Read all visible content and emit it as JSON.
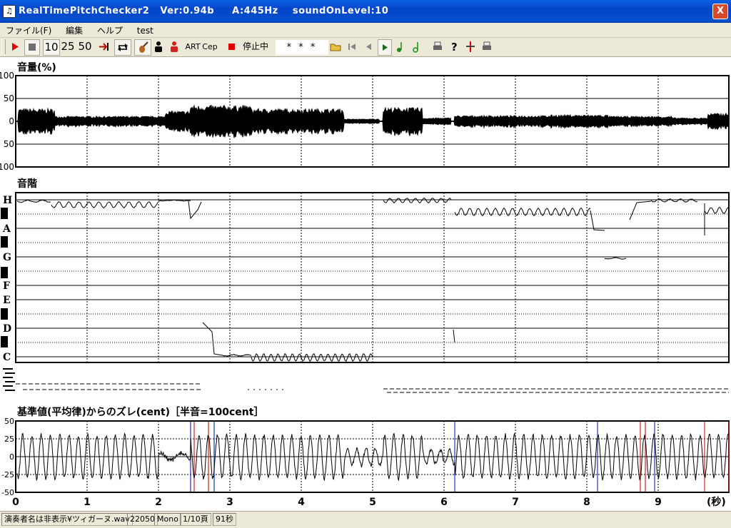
{
  "window": {
    "title": "RealTimePitchChecker2   Ver:0.94b     A:445Hz    soundOnLevel:10",
    "close_glyph": "X",
    "icon_glyph": "♫"
  },
  "menu": [
    "ファイル(F)",
    "編集",
    "ヘルプ",
    "test"
  ],
  "toolbar": {
    "zoom_10": "10",
    "zoom_25": "25",
    "zoom_50": "50",
    "art": "ART",
    "cep": "Cep",
    "status": "停止中",
    "note": "* * *"
  },
  "volume_panel": {
    "title": "音量(%)",
    "ticks": [
      "100",
      "50",
      "0",
      "50",
      "100"
    ]
  },
  "pitch_panel": {
    "title": "音階",
    "notes": [
      "H",
      "A",
      "G",
      "F",
      "E",
      "D",
      "C"
    ]
  },
  "cent_panel": {
    "title": "基準値(平均律)からのズレ(cent)［半音=100cent］",
    "ticks": [
      "50",
      "25",
      "0",
      "-25",
      "-50"
    ]
  },
  "time_axis": {
    "labels": [
      "0",
      "1",
      "2",
      "3",
      "4",
      "5",
      "6",
      "7",
      "8",
      "9"
    ],
    "unit": "(秒)"
  },
  "statusbar": {
    "file": "演奏者名は非表示¥ツィガーヌ.wav",
    "rate": "22050",
    "channels": "Mono",
    "page": "1/10頁",
    "length": "91秒"
  }
}
